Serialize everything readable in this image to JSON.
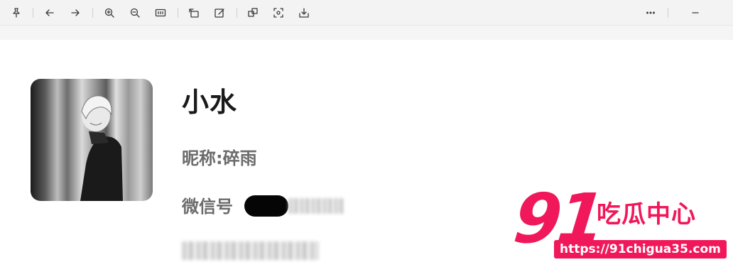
{
  "toolbar": {
    "icons": [
      "pin-icon",
      "back-arrow-icon",
      "forward-arrow-icon",
      "zoom-in-icon",
      "zoom-out-icon",
      "fit-width-icon",
      "rotate-icon",
      "edit-icon",
      "copy-icon",
      "crop-icon",
      "save-icon",
      "more-icon",
      "minimize-icon"
    ]
  },
  "profile": {
    "name": "小水",
    "nickname": "昵称:碎雨",
    "wechat_label": "微信号"
  },
  "watermark": {
    "number": "91",
    "text": "吃瓜中心",
    "url": "https://91chigua35.com",
    "color": "#f0185a"
  }
}
